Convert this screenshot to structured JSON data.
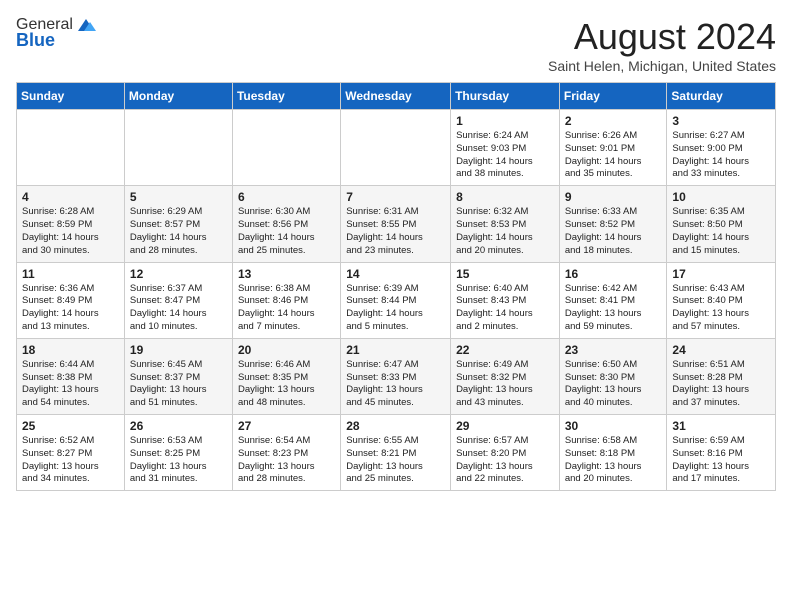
{
  "header": {
    "logo_general": "General",
    "logo_blue": "Blue",
    "month_title": "August 2024",
    "location": "Saint Helen, Michigan, United States"
  },
  "weekdays": [
    "Sunday",
    "Monday",
    "Tuesday",
    "Wednesday",
    "Thursday",
    "Friday",
    "Saturday"
  ],
  "weeks": [
    [
      {
        "day": "",
        "text": ""
      },
      {
        "day": "",
        "text": ""
      },
      {
        "day": "",
        "text": ""
      },
      {
        "day": "",
        "text": ""
      },
      {
        "day": "1",
        "text": "Sunrise: 6:24 AM\nSunset: 9:03 PM\nDaylight: 14 hours\nand 38 minutes."
      },
      {
        "day": "2",
        "text": "Sunrise: 6:26 AM\nSunset: 9:01 PM\nDaylight: 14 hours\nand 35 minutes."
      },
      {
        "day": "3",
        "text": "Sunrise: 6:27 AM\nSunset: 9:00 PM\nDaylight: 14 hours\nand 33 minutes."
      }
    ],
    [
      {
        "day": "4",
        "text": "Sunrise: 6:28 AM\nSunset: 8:59 PM\nDaylight: 14 hours\nand 30 minutes."
      },
      {
        "day": "5",
        "text": "Sunrise: 6:29 AM\nSunset: 8:57 PM\nDaylight: 14 hours\nand 28 minutes."
      },
      {
        "day": "6",
        "text": "Sunrise: 6:30 AM\nSunset: 8:56 PM\nDaylight: 14 hours\nand 25 minutes."
      },
      {
        "day": "7",
        "text": "Sunrise: 6:31 AM\nSunset: 8:55 PM\nDaylight: 14 hours\nand 23 minutes."
      },
      {
        "day": "8",
        "text": "Sunrise: 6:32 AM\nSunset: 8:53 PM\nDaylight: 14 hours\nand 20 minutes."
      },
      {
        "day": "9",
        "text": "Sunrise: 6:33 AM\nSunset: 8:52 PM\nDaylight: 14 hours\nand 18 minutes."
      },
      {
        "day": "10",
        "text": "Sunrise: 6:35 AM\nSunset: 8:50 PM\nDaylight: 14 hours\nand 15 minutes."
      }
    ],
    [
      {
        "day": "11",
        "text": "Sunrise: 6:36 AM\nSunset: 8:49 PM\nDaylight: 14 hours\nand 13 minutes."
      },
      {
        "day": "12",
        "text": "Sunrise: 6:37 AM\nSunset: 8:47 PM\nDaylight: 14 hours\nand 10 minutes."
      },
      {
        "day": "13",
        "text": "Sunrise: 6:38 AM\nSunset: 8:46 PM\nDaylight: 14 hours\nand 7 minutes."
      },
      {
        "day": "14",
        "text": "Sunrise: 6:39 AM\nSunset: 8:44 PM\nDaylight: 14 hours\nand 5 minutes."
      },
      {
        "day": "15",
        "text": "Sunrise: 6:40 AM\nSunset: 8:43 PM\nDaylight: 14 hours\nand 2 minutes."
      },
      {
        "day": "16",
        "text": "Sunrise: 6:42 AM\nSunset: 8:41 PM\nDaylight: 13 hours\nand 59 minutes."
      },
      {
        "day": "17",
        "text": "Sunrise: 6:43 AM\nSunset: 8:40 PM\nDaylight: 13 hours\nand 57 minutes."
      }
    ],
    [
      {
        "day": "18",
        "text": "Sunrise: 6:44 AM\nSunset: 8:38 PM\nDaylight: 13 hours\nand 54 minutes."
      },
      {
        "day": "19",
        "text": "Sunrise: 6:45 AM\nSunset: 8:37 PM\nDaylight: 13 hours\nand 51 minutes."
      },
      {
        "day": "20",
        "text": "Sunrise: 6:46 AM\nSunset: 8:35 PM\nDaylight: 13 hours\nand 48 minutes."
      },
      {
        "day": "21",
        "text": "Sunrise: 6:47 AM\nSunset: 8:33 PM\nDaylight: 13 hours\nand 45 minutes."
      },
      {
        "day": "22",
        "text": "Sunrise: 6:49 AM\nSunset: 8:32 PM\nDaylight: 13 hours\nand 43 minutes."
      },
      {
        "day": "23",
        "text": "Sunrise: 6:50 AM\nSunset: 8:30 PM\nDaylight: 13 hours\nand 40 minutes."
      },
      {
        "day": "24",
        "text": "Sunrise: 6:51 AM\nSunset: 8:28 PM\nDaylight: 13 hours\nand 37 minutes."
      }
    ],
    [
      {
        "day": "25",
        "text": "Sunrise: 6:52 AM\nSunset: 8:27 PM\nDaylight: 13 hours\nand 34 minutes."
      },
      {
        "day": "26",
        "text": "Sunrise: 6:53 AM\nSunset: 8:25 PM\nDaylight: 13 hours\nand 31 minutes."
      },
      {
        "day": "27",
        "text": "Sunrise: 6:54 AM\nSunset: 8:23 PM\nDaylight: 13 hours\nand 28 minutes."
      },
      {
        "day": "28",
        "text": "Sunrise: 6:55 AM\nSunset: 8:21 PM\nDaylight: 13 hours\nand 25 minutes."
      },
      {
        "day": "29",
        "text": "Sunrise: 6:57 AM\nSunset: 8:20 PM\nDaylight: 13 hours\nand 22 minutes."
      },
      {
        "day": "30",
        "text": "Sunrise: 6:58 AM\nSunset: 8:18 PM\nDaylight: 13 hours\nand 20 minutes."
      },
      {
        "day": "31",
        "text": "Sunrise: 6:59 AM\nSunset: 8:16 PM\nDaylight: 13 hours\nand 17 minutes."
      }
    ]
  ]
}
